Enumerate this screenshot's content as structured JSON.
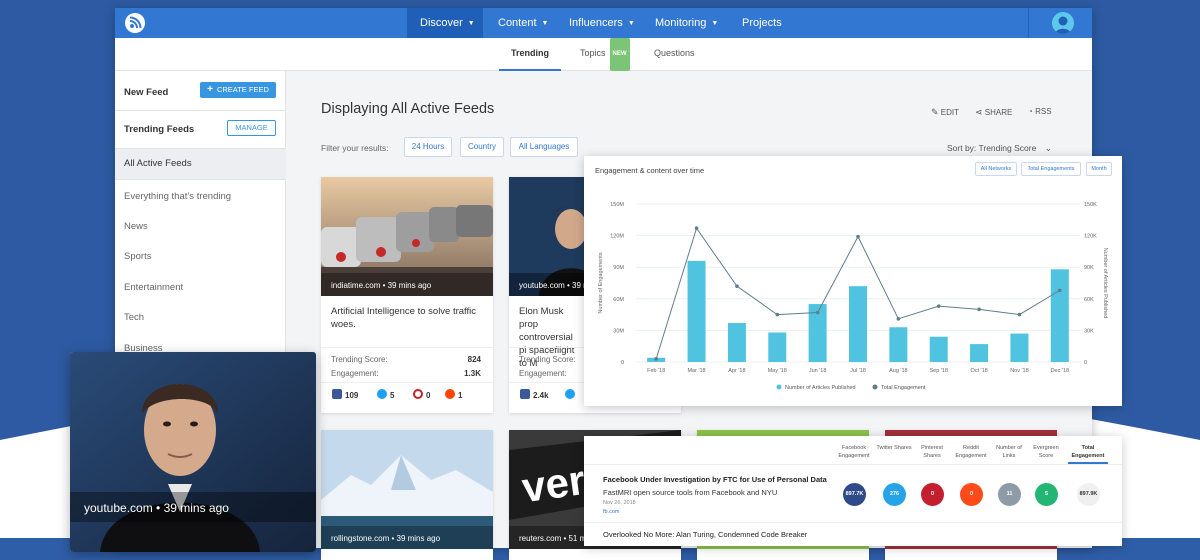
{
  "nav": {
    "items": [
      {
        "label": "Discover",
        "active": true,
        "has_caret": true
      },
      {
        "label": "Content",
        "active": false,
        "has_caret": true
      },
      {
        "label": "Influencers",
        "active": false,
        "has_caret": true
      },
      {
        "label": "Monitoring",
        "active": false,
        "has_caret": true
      },
      {
        "label": "Projects",
        "active": false,
        "has_caret": false
      }
    ]
  },
  "subnav": {
    "trending": "Trending",
    "topics": "Topics",
    "topics_badge": "NEW",
    "questions": "Questions"
  },
  "sidebar": {
    "new_feed": "New Feed",
    "create_feed": "CREATE FEED",
    "trending_feeds": "Trending Feeds",
    "manage": "MANAGE",
    "items": [
      "All Active Feeds",
      "Everything that’s trending",
      "News",
      "Sports",
      "Entertainment",
      "Tech",
      "Business"
    ]
  },
  "main": {
    "heading": "Displaying All Active Feeds",
    "edit": "EDIT",
    "share": "SHARE",
    "rss": "RSS",
    "filter_label": "Filter your results:",
    "filters": [
      "24 Hours",
      "Country",
      "All Languages"
    ],
    "sort_by": "Sort by: Trending Score"
  },
  "cards": [
    {
      "source": "indiatime.com • 39 mins ago",
      "title": "Artificial Intelligence to solve traffic woes.",
      "score_label": "Trending Score:",
      "score": "824",
      "engagement_label": "Engagement:",
      "engagement": "1.3K",
      "facebook": "109",
      "twitter": "5",
      "pinterest": "0",
      "reddit": "1"
    },
    {
      "source": "youtube.com • 39 mins ago",
      "title": "Elon Musk prop controversial pl spaceflight to M",
      "score_label": "Trending Score:",
      "engagement_label": "Engagement:",
      "facebook": "2.4k"
    }
  ],
  "bottom_cards": [
    {
      "source": "rollingstone.com • 39 mins ago"
    },
    {
      "source": "reuters.com • 51 m"
    }
  ],
  "overlay_card": {
    "source": "youtube.com • 39 mins ago"
  },
  "chart": {
    "title": "Engagement & content over time",
    "buttons": [
      "All Networks",
      "Total Engagements",
      "Month"
    ]
  },
  "chart_data": {
    "type": "bar",
    "categories": [
      "Feb '18",
      "Mar '18",
      "Apr '18",
      "May '18",
      "Jun '18",
      "Jul '18",
      "Aug '18",
      "Sep '18",
      "Oct '18",
      "Nov '18",
      "Dec '18"
    ],
    "series": [
      {
        "name": "Number of Articles Published",
        "type": "bar",
        "axis": "left",
        "values": [
          4,
          96,
          37,
          28,
          55,
          72,
          33,
          24,
          17,
          27,
          88
        ]
      },
      {
        "name": "Total Engagement",
        "type": "line",
        "axis": "right",
        "values": [
          3,
          127,
          72,
          45,
          47,
          119,
          41,
          53,
          50,
          45,
          68
        ]
      }
    ],
    "left_axis": {
      "label": "Number of Engagements",
      "ticks": [
        "0",
        "30M",
        "60M",
        "90M",
        "120M",
        "150M"
      ],
      "range": [
        0,
        150
      ]
    },
    "right_axis": {
      "label": "Number of Articles Published",
      "ticks": [
        "0",
        "30K",
        "60K",
        "90K",
        "120K",
        "150K"
      ],
      "range": [
        0,
        150
      ]
    },
    "legend_position": "bottom",
    "grid": true,
    "colors": {
      "bar": "#4fc3e0",
      "line": "#607d8b"
    }
  },
  "table": {
    "headers": [
      "Facebook Engagement",
      "Twitter Shares",
      "Pinterest Shares",
      "Reddit Engagement",
      "Number of Links",
      "Evergreen Score",
      "Total Engagement"
    ],
    "rows": [
      {
        "title": "Facebook Under Investigation by FTC for Use of Personal Data",
        "subtitle": "FastMRI open source tools from Facebook and NYU",
        "date": "Nov 26, 2018",
        "domain": "fb.com",
        "values": [
          "897.7K",
          "276",
          "0",
          "0",
          "11",
          "5",
          "897.9K"
        ]
      },
      {
        "title": "Overlooked No More: Alan Turing, Condemned Code Breaker"
      }
    ]
  }
}
